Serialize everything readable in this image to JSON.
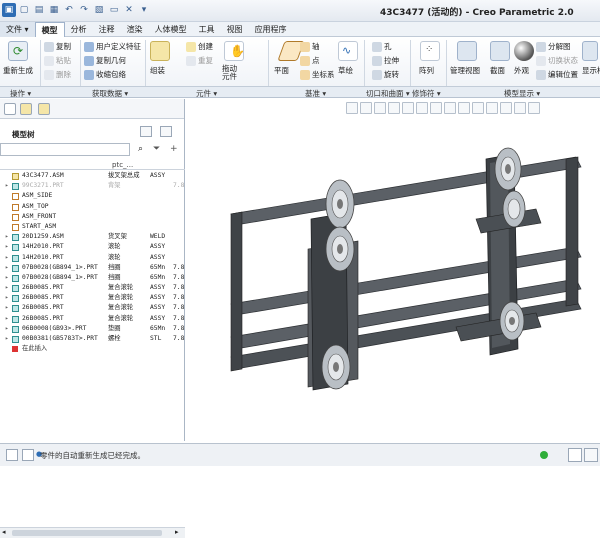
{
  "window": {
    "title": "43C3477 (活动的) - Creo Parametric 2.0"
  },
  "tabs": [
    {
      "label": "文件 ▾"
    },
    {
      "label": "模型"
    },
    {
      "label": "分析"
    },
    {
      "label": "注释"
    },
    {
      "label": "渲染"
    },
    {
      "label": "人体模型"
    },
    {
      "label": "工具"
    },
    {
      "label": "视图"
    },
    {
      "label": "应用程序"
    }
  ],
  "ribbon": {
    "regenerate": "重新生成",
    "copy": "复制",
    "paste": "粘贴",
    "delete": "删除",
    "udf": "用户定义特征",
    "copy_geom": "复制几何",
    "shrinkwrap": "收缩包络",
    "assemble": "组装",
    "create": "创建",
    "repeat": "重复",
    "drag": "拖动\n元件",
    "plane": "平面",
    "axis": "轴",
    "point": "点",
    "csys": "坐标系",
    "sketch": "草绘",
    "hole": "孔",
    "extrude": "拉伸",
    "revolve": "旋转",
    "pattern": "阵列",
    "manage_views": "管理视图",
    "section": "截面",
    "appearance": "外观",
    "exploded": "分解图",
    "toggle_state": "切换状态",
    "edit_pos": "编辑位置",
    "display_style": "显示样式"
  },
  "groups": [
    "操作 ▾",
    "获取数据 ▾",
    "元件 ▾",
    "基准 ▾",
    "切口和曲面 ▾",
    "修饰符 ▾",
    "模型显示 ▾"
  ],
  "model_tree": {
    "title": "模型树",
    "columns": [
      "ptc_..."
    ],
    "rows": [
      {
        "name": "43C3477.ASM",
        "c1": "拔叉架总成",
        "c2": "ASSY",
        "c3": "",
        "dim": false,
        "exp": ""
      },
      {
        "name": "99C3271.PRT",
        "c1": "背架",
        "c2": "",
        "c3": "7.8",
        "dim": true,
        "exp": "▸"
      },
      {
        "name": "ASM_SIDE",
        "c1": "",
        "c2": "",
        "c3": "",
        "dim": false,
        "exp": ""
      },
      {
        "name": "ASM_TOP",
        "c1": "",
        "c2": "",
        "c3": "",
        "dim": false,
        "exp": ""
      },
      {
        "name": "ASM_FRONT",
        "c1": "",
        "c2": "",
        "c3": "",
        "dim": false,
        "exp": ""
      },
      {
        "name": "START_ASM",
        "c1": "",
        "c2": "",
        "c3": "",
        "dim": false,
        "exp": ""
      },
      {
        "name": "20D1259.ASM",
        "c1": "货叉架",
        "c2": "WELD",
        "c3": "",
        "dim": false,
        "exp": "▸"
      },
      {
        "name": "14H2010.PRT",
        "c1": "滚轮",
        "c2": "ASSY",
        "c3": "",
        "dim": false,
        "exp": "▸"
      },
      {
        "name": "14H2010.PRT",
        "c1": "滚轮",
        "c2": "ASSY",
        "c3": "",
        "dim": false,
        "exp": "▸"
      },
      {
        "name": "07B0028(GB894_1>.PRT",
        "c1": "挡圈",
        "c2": "65Mn",
        "c3": "7.8",
        "dim": false,
        "exp": "▸"
      },
      {
        "name": "07B0028(GB894_1>.PRT",
        "c1": "挡圈",
        "c2": "65Mn",
        "c3": "7.8",
        "dim": false,
        "exp": "▸"
      },
      {
        "name": "26B0085.PRT",
        "c1": "复合滚轮",
        "c2": "ASSY",
        "c3": "7.8",
        "dim": false,
        "exp": "▸"
      },
      {
        "name": "26B0085.PRT",
        "c1": "复合滚轮",
        "c2": "ASSY",
        "c3": "7.8",
        "dim": false,
        "exp": "▸"
      },
      {
        "name": "26B0085.PRT",
        "c1": "复合滚轮",
        "c2": "ASSY",
        "c3": "7.8",
        "dim": false,
        "exp": "▸"
      },
      {
        "name": "26B0085.PRT",
        "c1": "复合滚轮",
        "c2": "ASSY",
        "c3": "7.8",
        "dim": false,
        "exp": "▸"
      },
      {
        "name": "06B0008(GB93>.PRT",
        "c1": "垫圈",
        "c2": "65Mn",
        "c3": "7.8",
        "dim": false,
        "exp": "▸"
      },
      {
        "name": "00B0381(GB5783T>.PRT",
        "c1": "螺栓",
        "c2": "STL",
        "c3": "7.8",
        "dim": false,
        "exp": "▸"
      },
      {
        "name": "在此插入",
        "c1": "",
        "c2": "",
        "c3": "",
        "dim": false,
        "exp": ""
      }
    ]
  },
  "status": {
    "message": "零件的自动重新生成已经完成。"
  },
  "colors": {
    "accent": "#3a6fb0",
    "model_dark": "#3f4347",
    "model_mid": "#5b6066",
    "roller": "#c9ced3"
  }
}
